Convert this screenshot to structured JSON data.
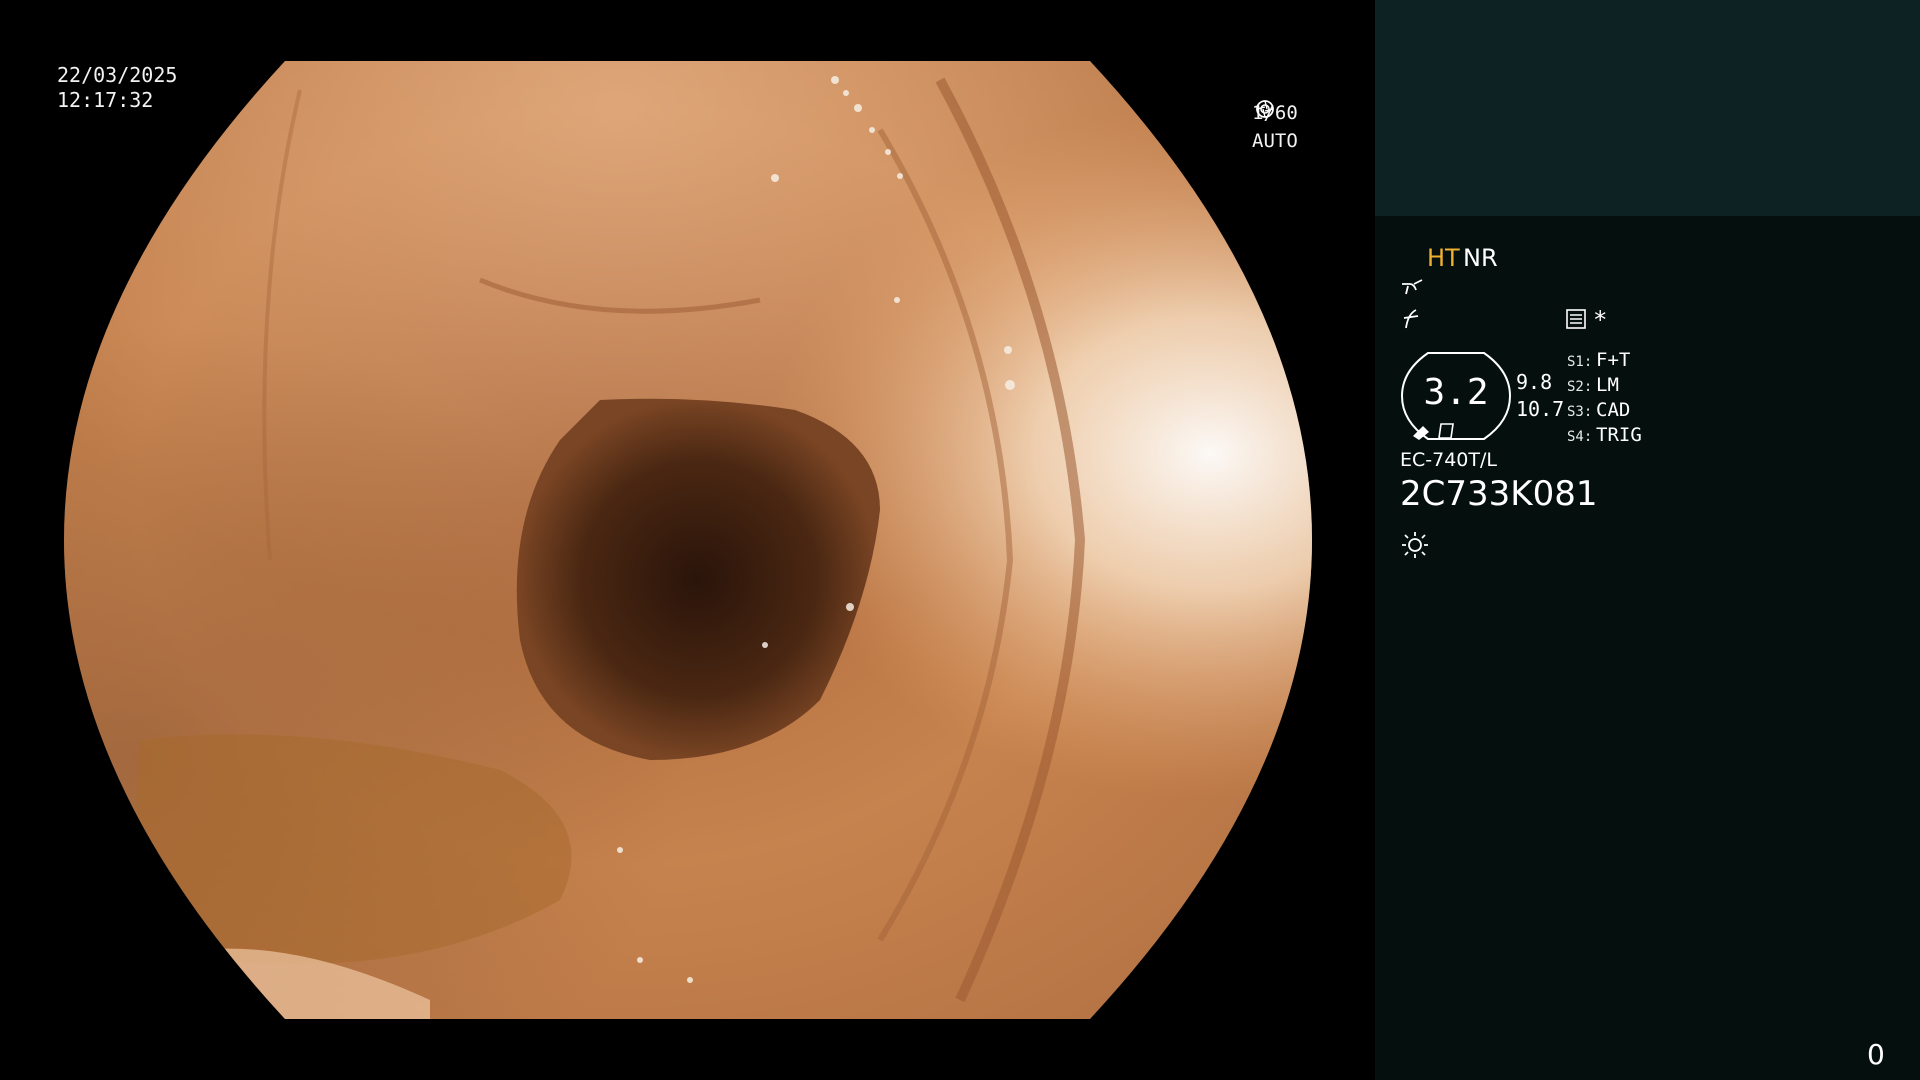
{
  "osd": {
    "date": "22/03/2025",
    "time": "12:17:32",
    "shutter": "1/60",
    "exposure": "AUTO"
  },
  "panel": {
    "mode_ht": "HT",
    "mode_nr": "NR",
    "zoom": "3.2",
    "value_a": "9.8",
    "value_b": "10.7",
    "asterisk": "*",
    "switches": [
      {
        "label": "S1:",
        "value": "F+T"
      },
      {
        "label": "S2:",
        "value": "LM"
      },
      {
        "label": "S3:",
        "value": "CAD"
      },
      {
        "label": "S4:",
        "value": "TRIG"
      }
    ],
    "scope_model": "EC-740T/L",
    "serial": "2C733K081",
    "counter": "0"
  },
  "colors": {
    "ht_accent": "#f0b030",
    "panel_top": "#0d2223",
    "panel_bg": "#050f0e",
    "mucosa": "#c07a45"
  }
}
